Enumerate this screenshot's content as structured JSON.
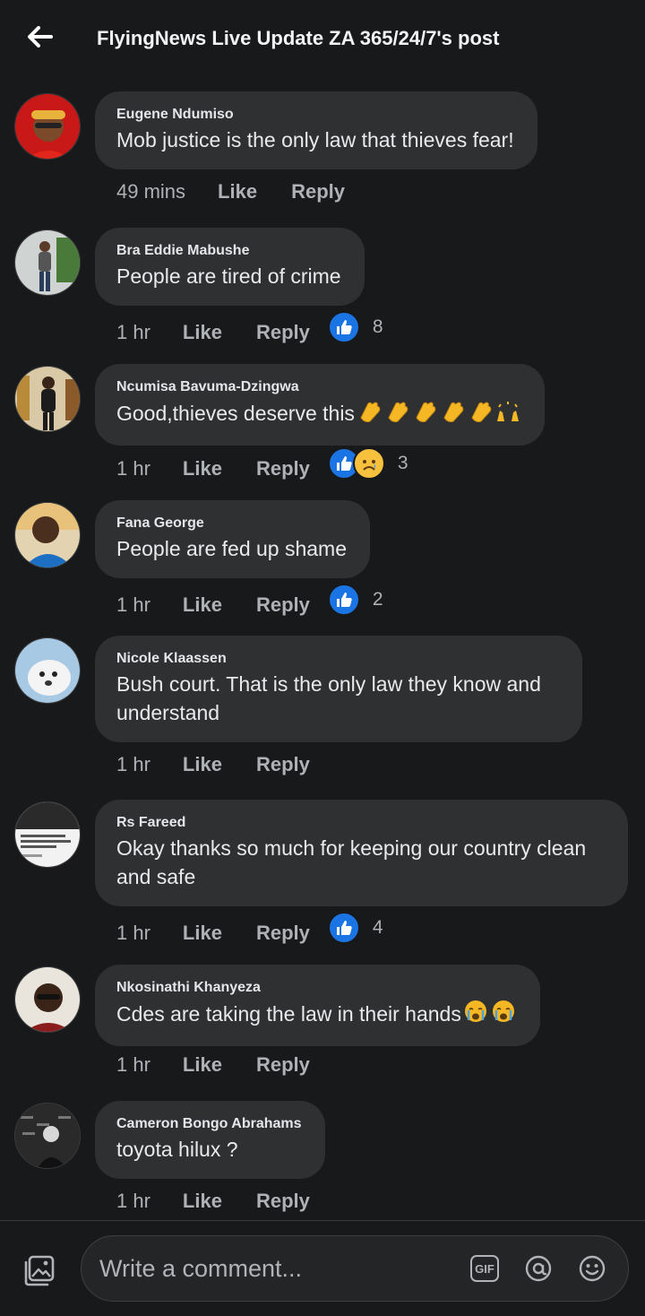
{
  "header": {
    "title": "FlyingNews Live Update ZA 365/24/7's post"
  },
  "comments": [
    {
      "author": "Eugene Ndumiso",
      "text": "Mob justice is the only law that thieves fear!",
      "time": "49 mins",
      "like_label": "Like",
      "reply_label": "Reply",
      "reaction_count": ""
    },
    {
      "author": "Bra Eddie Mabushe",
      "text": "People are tired of crime",
      "time": "1 hr",
      "like_label": "Like",
      "reply_label": "Reply",
      "reaction_count": "8"
    },
    {
      "author": "Ncumisa Bavuma-Dzingwa",
      "text": "Good,thieves deserve this",
      "time": "1 hr",
      "like_label": "Like",
      "reply_label": "Reply",
      "reaction_count": "3"
    },
    {
      "author": "Fana George",
      "text": "People are fed up shame",
      "time": "1 hr",
      "like_label": "Like",
      "reply_label": "Reply",
      "reaction_count": "2"
    },
    {
      "author": "Nicole Klaassen",
      "text": "Bush court. That is the only law they know and understand",
      "time": "1 hr",
      "like_label": "Like",
      "reply_label": "Reply",
      "reaction_count": ""
    },
    {
      "author": "Rs Fareed",
      "text": "Okay thanks so much for keeping our country clean and safe",
      "time": "1 hr",
      "like_label": "Like",
      "reply_label": "Reply",
      "reaction_count": "4"
    },
    {
      "author": "Nkosinathi Khanyeza",
      "text": "Cdes are taking the law in their hands",
      "time": "1 hr",
      "like_label": "Like",
      "reply_label": "Reply",
      "reaction_count": ""
    },
    {
      "author": "Cameron Bongo Abrahams",
      "text": "toyota hilux ?",
      "time": "1 hr",
      "like_label": "Like",
      "reply_label": "Reply",
      "reaction_count": ""
    }
  ],
  "composer": {
    "placeholder": "Write a comment...",
    "gif_label": "GIF"
  },
  "colors": {
    "background": "#18191b",
    "bubble": "#2f3031",
    "like_blue": "#1b74e4",
    "muted_text": "#aeb1b6"
  },
  "icons": {
    "back": "arrow-left-icon",
    "photo": "photo-icon",
    "gif": "gif-icon",
    "mention": "at-sign-icon",
    "emoji": "smiley-icon",
    "like_reaction": "thumbs-up-icon",
    "sad_reaction": "sad-face-icon",
    "clap": "clapping-hands-emoji",
    "raised_hands": "raised-hands-emoji",
    "crying": "crying-face-emoji"
  }
}
